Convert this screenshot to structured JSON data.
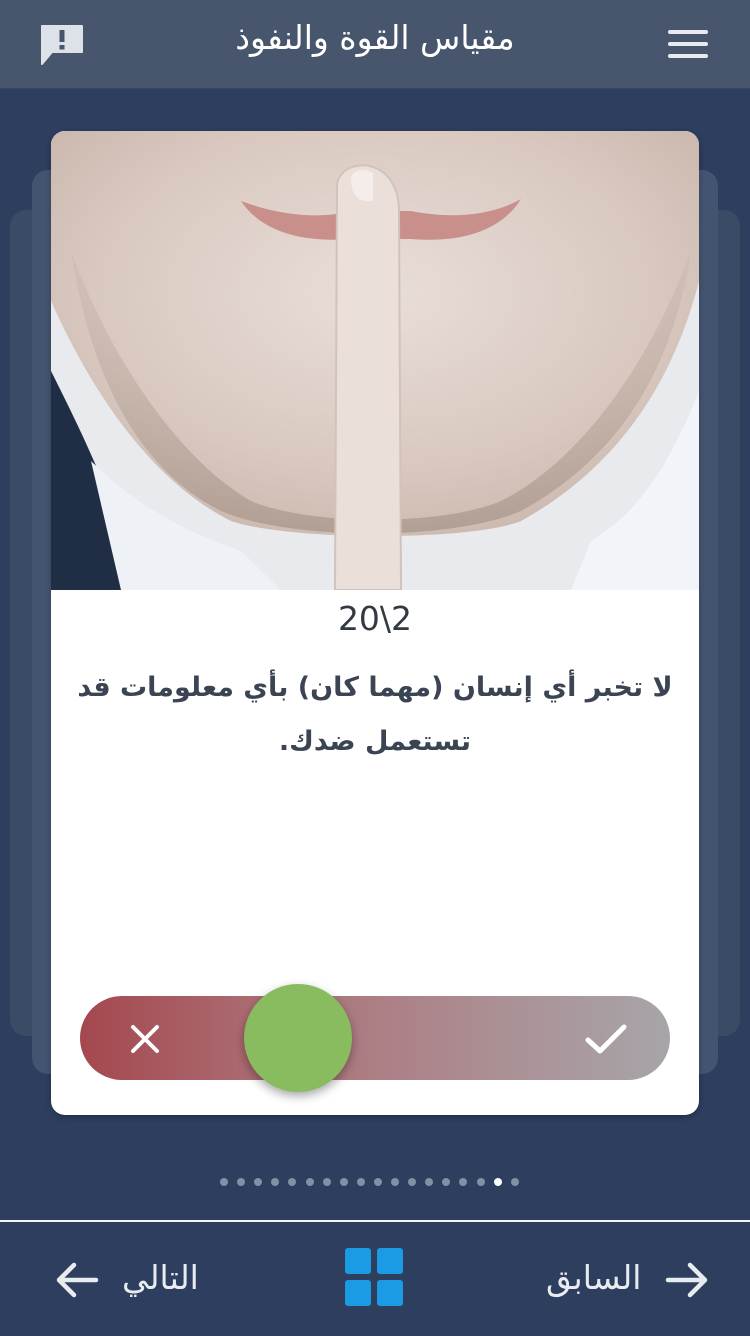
{
  "header": {
    "title": "مقياس القوة والنفوذ"
  },
  "card": {
    "counter": "20\\2",
    "statement": "لا تخبر أي إنسان (مهما كان) بأي معلومات قد تستعمل ضدك."
  },
  "slider": {
    "knob_position": 0.37
  },
  "pagination": {
    "total": 18,
    "active_index": 16
  },
  "footer": {
    "next_label": "التالي",
    "prev_label": "السابق"
  },
  "colors": {
    "background": "#2d3e5e",
    "header": "#47566c",
    "knob": "#88bc5f",
    "accent_blue": "#1b9be3",
    "slider_reject": "#a4484e"
  },
  "icons": {
    "feedback": "report-icon",
    "menu": "hamburger-menu-icon",
    "reject": "close-icon",
    "accept": "check-icon",
    "next": "arrow-left-icon",
    "prev": "arrow-right-icon",
    "grid": "grid-icon"
  }
}
